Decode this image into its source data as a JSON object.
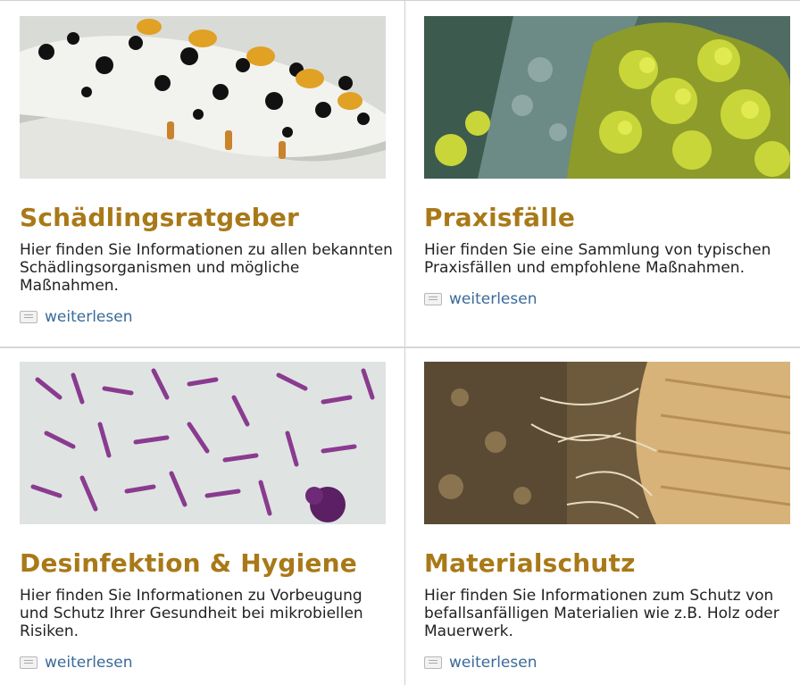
{
  "cards": [
    {
      "title": "Schädlingsratgeber",
      "description": "Hier finden Sie Informationen zu allen bekannten Schädlingsorganismen und mögliche Maßnahmen.",
      "link": "weiterlesen"
    },
    {
      "title": "Praxisfälle",
      "description": "Hier finden Sie eine Sammlung von typischen Praxisfällen und empfohlene Maßnahmen.",
      "link": "weiterlesen"
    },
    {
      "title": "Desinfektion & Hygiene",
      "description": "Hier finden Sie Informationen zu Vorbeugung und Schutz Ihrer Gesundheit bei mikrobiellen Risiken.",
      "link": "weiterlesen"
    },
    {
      "title": "Materialschutz",
      "description": "Hier finden Sie Informationen zum Schutz von befallsanfälligen Materialien wie z.B. Holz oder Mauerwerk.",
      "link": "weiterlesen"
    }
  ],
  "colors": {
    "title": "#a97918",
    "link": "#3a6a9a"
  }
}
